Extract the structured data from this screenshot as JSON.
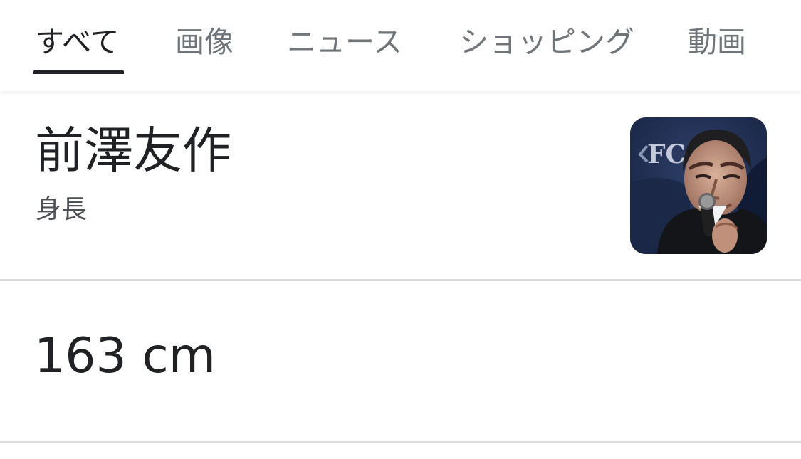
{
  "tabs": [
    {
      "label": "すべて",
      "active": true
    },
    {
      "label": "画像",
      "active": false
    },
    {
      "label": "ニュース",
      "active": false
    },
    {
      "label": "ショッピング",
      "active": false
    },
    {
      "label": "動画",
      "active": false
    }
  ],
  "entity": {
    "title": "前澤友作",
    "subtitle": "身長",
    "thumbnail_backdrop_text": "FC"
  },
  "answer": {
    "value": "163 cm"
  },
  "colors": {
    "text_primary": "#202124",
    "text_secondary": "#70757a",
    "divider": "#dadce0",
    "thumbnail_background": "#1f2b4d"
  }
}
